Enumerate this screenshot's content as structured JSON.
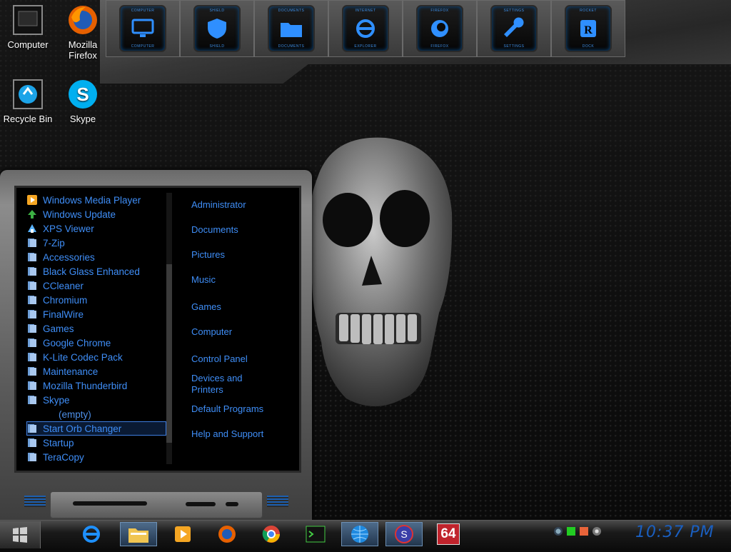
{
  "desktop": {
    "icons": [
      {
        "label": "Computer"
      },
      {
        "label": "Mozilla Firefox"
      },
      {
        "label": "Recycle Bin"
      },
      {
        "label": "Skype"
      }
    ]
  },
  "dock": {
    "items": [
      {
        "name": "Computer",
        "icon": "monitor-icon"
      },
      {
        "name": "Shield",
        "icon": "shield-icon"
      },
      {
        "name": "Documents",
        "icon": "folder-icon"
      },
      {
        "name": "Internet Explorer",
        "icon": "ie-icon"
      },
      {
        "name": "Firefox",
        "icon": "firefox-icon"
      },
      {
        "name": "Settings",
        "icon": "wrench-icon"
      },
      {
        "name": "Rocket Dock",
        "icon": "rocketdock-icon"
      }
    ]
  },
  "start_menu": {
    "programs": [
      {
        "label": "Windows Media Player",
        "icon": "media-player-icon"
      },
      {
        "label": "Windows Update",
        "icon": "update-icon"
      },
      {
        "label": "XPS Viewer",
        "icon": "xps-icon"
      },
      {
        "label": "7-Zip",
        "icon": "folder-icon"
      },
      {
        "label": "Accessories",
        "icon": "folder-icon"
      },
      {
        "label": "Black Glass Enhanced",
        "icon": "folder-icon"
      },
      {
        "label": "CCleaner",
        "icon": "folder-icon"
      },
      {
        "label": "Chromium",
        "icon": "folder-icon"
      },
      {
        "label": "FinalWire",
        "icon": "folder-icon"
      },
      {
        "label": "Games",
        "icon": "folder-icon"
      },
      {
        "label": "Google Chrome",
        "icon": "folder-icon"
      },
      {
        "label": "K-Lite Codec Pack",
        "icon": "folder-icon"
      },
      {
        "label": "Maintenance",
        "icon": "folder-icon"
      },
      {
        "label": "Mozilla Thunderbird",
        "icon": "folder-icon"
      },
      {
        "label": "Skype",
        "icon": "folder-icon"
      },
      {
        "label": "(empty)",
        "icon": ""
      },
      {
        "label": "Start Orb Changer",
        "icon": "folder-icon",
        "selected": true
      },
      {
        "label": "Startup",
        "icon": "folder-icon"
      },
      {
        "label": "TeraCopy",
        "icon": "folder-icon"
      }
    ],
    "links": [
      {
        "label": "Administrator"
      },
      {
        "label": "Documents"
      },
      {
        "label": "Pictures"
      },
      {
        "label": "Music"
      },
      {
        "label": "Games"
      },
      {
        "label": "Computer"
      },
      {
        "label": "Control Panel"
      },
      {
        "label": "Devices and Printers"
      },
      {
        "label": "Default Programs"
      },
      {
        "label": "Help and Support"
      }
    ]
  },
  "taskbar": {
    "pinned": [
      {
        "name": "Internet Explorer",
        "icon": "ie-icon"
      },
      {
        "name": "Windows Explorer",
        "icon": "explorer-folder-icon"
      },
      {
        "name": "Media Player",
        "icon": "media-player-icon"
      },
      {
        "name": "Firefox",
        "icon": "firefox-icon"
      },
      {
        "name": "Chrome",
        "icon": "chrome-icon"
      },
      {
        "name": "Command Prompt",
        "icon": "terminal-icon"
      },
      {
        "name": "Globe",
        "icon": "globe-icon"
      },
      {
        "name": "Skype",
        "icon": "skype-icon"
      },
      {
        "name": "64-bit tool",
        "icon": "64-icon",
        "text": "64"
      }
    ],
    "clock": "10:37 PM"
  },
  "colors": {
    "link_blue": "#3f8ef7",
    "accent_blue": "#1a5fc0"
  }
}
